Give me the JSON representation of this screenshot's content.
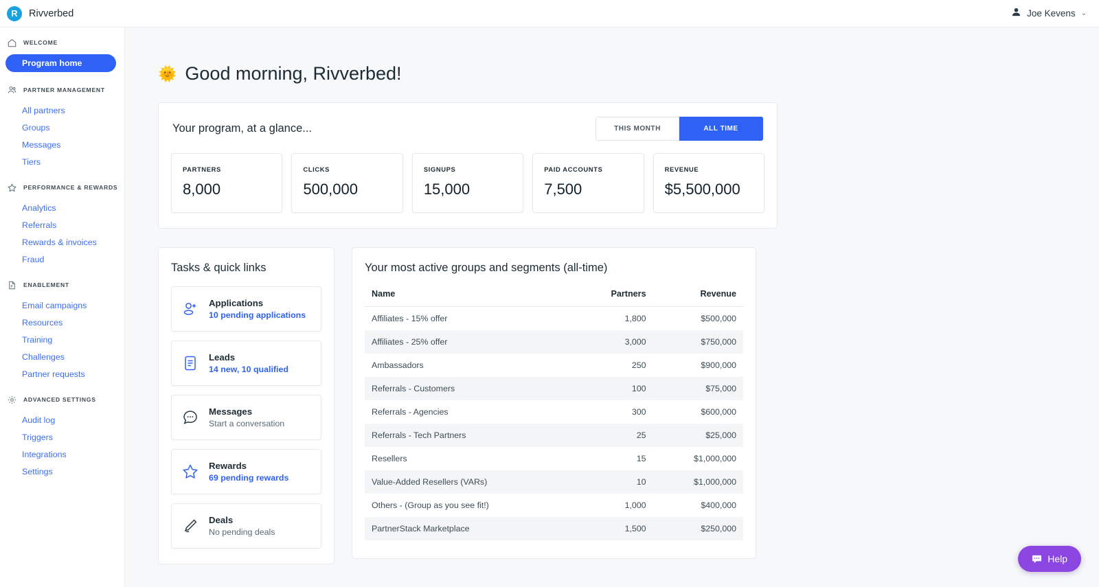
{
  "topbar": {
    "logo_letter": "R",
    "brand": "Rivverbed",
    "user": "Joe Kevens",
    "caret": "⌄"
  },
  "sidebar": {
    "groups": [
      {
        "icon": "home-icon",
        "label": "WELCOME",
        "items": [
          {
            "label": "Program home",
            "active": true
          }
        ]
      },
      {
        "icon": "people-icon",
        "label": "PARTNER MANAGEMENT",
        "items": [
          {
            "label": "All partners",
            "active": false
          },
          {
            "label": "Groups",
            "active": false
          },
          {
            "label": "Messages",
            "active": false
          },
          {
            "label": "Tiers",
            "active": false
          }
        ]
      },
      {
        "icon": "star-icon",
        "label": "PERFORMANCE & REWARDS",
        "items": [
          {
            "label": "Analytics",
            "active": false
          },
          {
            "label": "Referrals",
            "active": false
          },
          {
            "label": "Rewards & invoices",
            "active": false
          },
          {
            "label": "Fraud",
            "active": false
          }
        ]
      },
      {
        "icon": "document-icon",
        "label": "ENABLEMENT",
        "items": [
          {
            "label": "Email campaigns",
            "active": false
          },
          {
            "label": "Resources",
            "active": false
          },
          {
            "label": "Training",
            "active": false
          },
          {
            "label": "Challenges",
            "active": false
          },
          {
            "label": "Partner requests",
            "active": false
          }
        ]
      },
      {
        "icon": "gear-icon",
        "label": "ADVANCED SETTINGS",
        "items": [
          {
            "label": "Audit log",
            "active": false
          },
          {
            "label": "Triggers",
            "active": false
          },
          {
            "label": "Integrations",
            "active": false
          },
          {
            "label": "Settings",
            "active": false
          }
        ]
      }
    ]
  },
  "main": {
    "greeting_emoji": "🌞",
    "greeting": "Good morning, Rivverbed!",
    "glance": {
      "title": "Your program, at a glance...",
      "range_options": [
        "THIS MONTH",
        "ALL TIME"
      ],
      "range_selected": "ALL TIME",
      "stats": [
        {
          "label": "PARTNERS",
          "value": "8,000"
        },
        {
          "label": "CLICKS",
          "value": "500,000"
        },
        {
          "label": "SIGNUPS",
          "value": "15,000"
        },
        {
          "label": "PAID ACCOUNTS",
          "value": "7,500"
        },
        {
          "label": "REVENUE",
          "value": "$5,500,000"
        }
      ]
    },
    "tasks": {
      "title": "Tasks & quick links",
      "items": [
        {
          "icon": "person-add-icon",
          "title": "Applications",
          "sub": "10 pending applications",
          "sub_is_link": true
        },
        {
          "icon": "leads-document-icon",
          "title": "Leads",
          "sub": "14 new, 10 qualified",
          "sub_is_link": true
        },
        {
          "icon": "chat-bubble-icon",
          "title": "Messages",
          "sub": "Start a conversation",
          "sub_is_link": false
        },
        {
          "icon": "star-outline-icon",
          "title": "Rewards",
          "sub": "69 pending rewards",
          "sub_is_link": true
        },
        {
          "icon": "pencil-icon",
          "title": "Deals",
          "sub": "No pending deals",
          "sub_is_link": false
        }
      ]
    },
    "groups_table": {
      "title": "Your most active groups and segments (all-time)",
      "columns": [
        "Name",
        "Partners",
        "Revenue"
      ],
      "rows": [
        {
          "name": "Affiliates - 15% offer",
          "partners": "1,800",
          "revenue": "$500,000"
        },
        {
          "name": "Affiliates - 25% offer",
          "partners": "3,000",
          "revenue": "$750,000"
        },
        {
          "name": "Ambassadors",
          "partners": "250",
          "revenue": "$900,000"
        },
        {
          "name": "Referrals - Customers",
          "partners": "100",
          "revenue": "$75,000"
        },
        {
          "name": "Referrals - Agencies",
          "partners": "300",
          "revenue": "$600,000"
        },
        {
          "name": "Referrals - Tech Partners",
          "partners": "25",
          "revenue": "$25,000"
        },
        {
          "name": "Resellers",
          "partners": "15",
          "revenue": "$1,000,000"
        },
        {
          "name": "Value-Added Resellers (VARs)",
          "partners": "10",
          "revenue": "$1,000,000"
        },
        {
          "name": "Others - (Group as you see fit!)",
          "partners": "1,000",
          "revenue": "$400,000"
        },
        {
          "name": "PartnerStack Marketplace",
          "partners": "1,500",
          "revenue": "$250,000"
        }
      ]
    }
  },
  "help": {
    "label": "Help",
    "icon": "chat-help-icon"
  },
  "colors": {
    "accent_blue": "#2f62f4",
    "link_blue": "#3b6ef5",
    "logo_cyan": "#18a2e0",
    "help_purple": "#8b45e0",
    "page_bg": "#f6f8fa"
  }
}
